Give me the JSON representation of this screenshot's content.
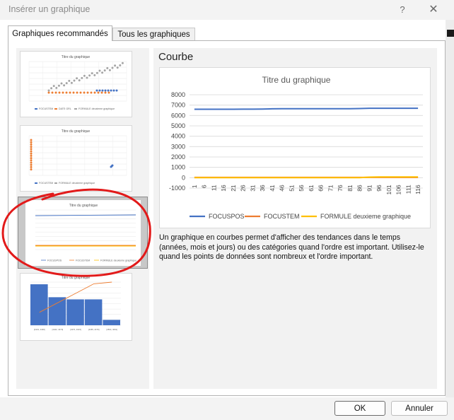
{
  "window": {
    "title": "Insérer un graphique",
    "help_icon": "?",
    "close_icon": "✕"
  },
  "tabs": [
    {
      "label": "Graphiques recommandés",
      "active": true
    },
    {
      "label": "Tous les graphiques",
      "active": false
    }
  ],
  "thumbnails": [
    {
      "kind": "scatter",
      "title": "Titre du graphique",
      "legend": [
        "FOCUSTEM",
        "DATE GRL",
        "FORMULE deuxieme graphique"
      ]
    },
    {
      "kind": "scatter",
      "title": "Titre du graphique",
      "legend": [
        "FOCUSTEM",
        "FORMULE deuxieme graphique"
      ]
    },
    {
      "kind": "line",
      "title": "Titre du graphique",
      "legend": [
        "FOCUSPOS",
        "FOCUSTEM",
        "FORMULE deuxieme graphique"
      ],
      "selected": true
    },
    {
      "kind": "pareto",
      "title": "Titre du graphique",
      "categories": [
        "[4419, 4438]",
        "[4422, 4470]",
        "[4370, 4615]",
        "[4465, 4479]",
        "[4504, 4691]"
      ]
    }
  ],
  "preview": {
    "heading": "Courbe",
    "description": "Un graphique en courbes permet d'afficher des tendances dans le temps (années, mois et jours) ou des catégories quand l'ordre est important. Utilisez-le quand les points de données sont nombreux et l'ordre important."
  },
  "chart_data": {
    "type": "line",
    "title": "Titre du graphique",
    "xlabel": "",
    "ylabel": "",
    "ylim": [
      -1000,
      8000
    ],
    "yticks": [
      8000,
      7000,
      6000,
      5000,
      4000,
      3000,
      2000,
      1000,
      0,
      -1000
    ],
    "categories": [
      "1",
      "6",
      "11",
      "16",
      "21",
      "26",
      "31",
      "36",
      "41",
      "46",
      "51",
      "56",
      "61",
      "66",
      "71",
      "76",
      "81",
      "86",
      "91",
      "96",
      "101",
      "106",
      "111",
      "116"
    ],
    "grid": true,
    "legend_position": "bottom",
    "series": [
      {
        "name": "FOCUSPOS",
        "color": "#4472c4",
        "values": [
          6600,
          6600,
          6600,
          6600,
          6600,
          6610,
          6610,
          6620,
          6640,
          6650,
          6650,
          6650,
          6650,
          6650,
          6660,
          6660,
          6660,
          6670,
          6700,
          6700,
          6700,
          6700,
          6700,
          6700
        ]
      },
      {
        "name": "FOCUSTEM",
        "color": "#ed7d31",
        "values": [
          30,
          30,
          30,
          30,
          30,
          30,
          30,
          30,
          30,
          30,
          30,
          30,
          30,
          30,
          30,
          30,
          30,
          30,
          30,
          30,
          30,
          30,
          30,
          30
        ]
      },
      {
        "name": "FORMULE deuxieme graphique",
        "color": "#ffc000",
        "values": [
          0,
          0,
          0,
          0,
          0,
          0,
          0,
          0,
          0,
          0,
          0,
          0,
          0,
          0,
          0,
          0,
          0,
          0,
          60,
          70,
          70,
          70,
          70,
          70
        ]
      }
    ]
  },
  "buttons": {
    "ok": "OK",
    "cancel": "Annuler"
  }
}
